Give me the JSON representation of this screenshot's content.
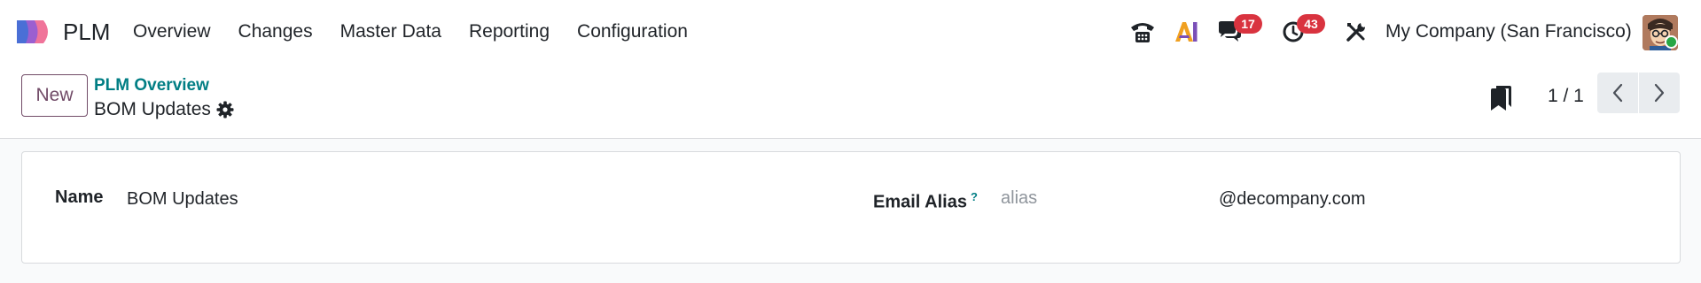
{
  "navbar": {
    "app_name": "PLM",
    "menu": [
      {
        "label": "Overview"
      },
      {
        "label": "Changes"
      },
      {
        "label": "Master Data"
      },
      {
        "label": "Reporting"
      },
      {
        "label": "Configuration"
      }
    ],
    "systray": {
      "messages_count": "17",
      "activities_count": "43",
      "company": "My Company (San Francisco)"
    }
  },
  "control_panel": {
    "new_label": "New",
    "breadcrumb": "PLM Overview",
    "record_title": "BOM Updates",
    "pager": "1 / 1"
  },
  "form": {
    "name_label": "Name",
    "name_value": "BOM Updates",
    "email_alias_label": "Email Alias",
    "email_alias_help": "?",
    "alias_placeholder": "alias",
    "alias_domain": "@decompany.com"
  },
  "icons": {
    "app": "plm-logo-icon",
    "phone": "phone-icon",
    "ai": "ai-icon",
    "messages": "chat-bubble-icon",
    "activities": "clock-icon",
    "tools": "tools-icon",
    "settings": "gear-icon",
    "bookmark": "bookmark-icon",
    "prev": "chevron-left-icon",
    "next": "chevron-right-icon"
  },
  "colors": {
    "brand": "#714b67",
    "link": "#017e84",
    "badge": "#d9333f",
    "online": "#28a745"
  }
}
